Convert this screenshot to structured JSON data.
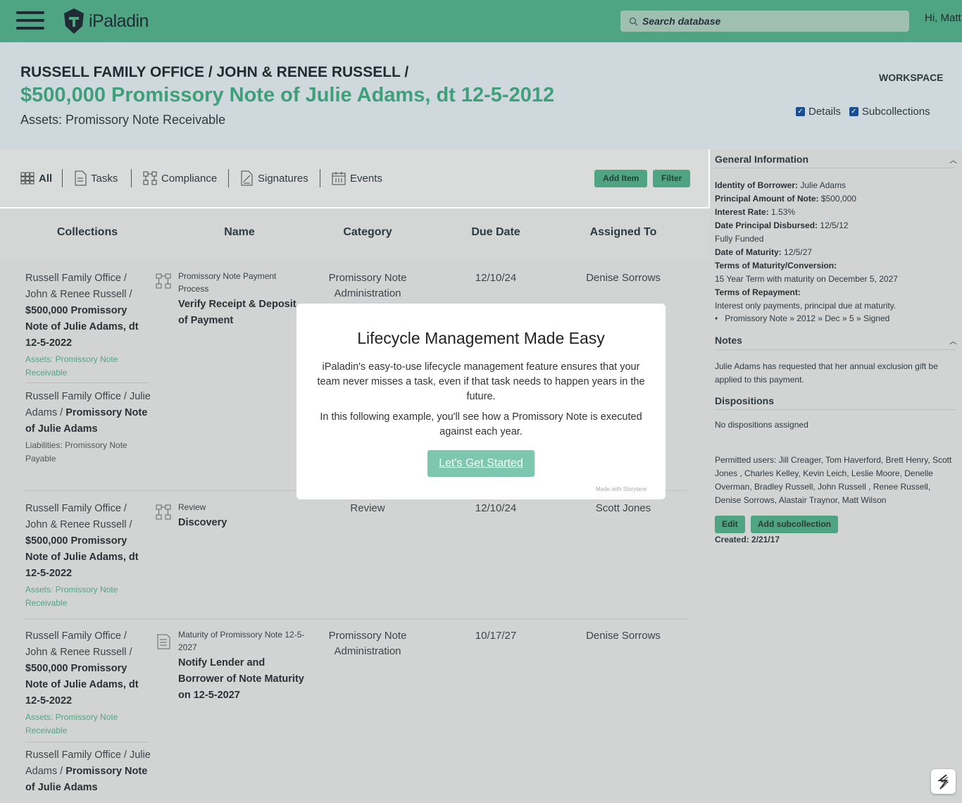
{
  "app": {
    "logo_text": "iPaladin",
    "search_placeholder": "Search database",
    "greeting": "Hi, Matt"
  },
  "header": {
    "breadcrumb": "RUSSELL FAMILY OFFICE / JOHN & RENEE RUSSELL /",
    "title": "$500,000 Promissory Note of Julie Adams, dt 12-5-2012",
    "subtitle": "Assets: Promissory Note Receivable",
    "workspace_label": "WORKSPACE",
    "details_label": "Details",
    "subcollections_label": "Subcollections"
  },
  "tabs": {
    "all": "All",
    "tasks": "Tasks",
    "compliance": "Compliance",
    "signatures": "Signatures",
    "events": "Events",
    "add_item": "Add Item",
    "filter": "Filter"
  },
  "table": {
    "headers": {
      "collections": "Collections",
      "name": "Name",
      "category": "Category",
      "due_date": "Due Date",
      "assigned_to": "Assigned To"
    },
    "rows": [
      {
        "coll_a_plain": "Russell Family Office / John & Renee Russell /",
        "coll_a_bold": "$500,000 Promissory Note of Julie Adams, dt 12-5-2022",
        "coll_a_tag": "Assets: Promissory Note Receivable",
        "coll_b_plain": "Russell Family Office / Julie Adams /",
        "coll_b_bold": "Promissory Note of Julie Adams",
        "coll_b_tag": "Liabilities: Promissory Note Payable",
        "process": "Promissory Note Payment Process",
        "title": "Verify Receipt & Deposit of Payment",
        "category": "Promissory Note Administration",
        "due": "12/10/24",
        "assigned": "Denise Sorrows"
      },
      {
        "coll_a_plain": "Russell Family Office / John & Renee Russell /",
        "coll_a_bold": "$500,000 Promissory Note of Julie Adams, dt 12-5-2022",
        "coll_a_tag": "Assets: Promissory Note Receivable",
        "process": "Review",
        "title": "Discovery",
        "category": "Review",
        "due": "12/10/24",
        "assigned": "Scott Jones"
      },
      {
        "coll_a_plain": "Russell Family Office / John & Renee Russell /",
        "coll_a_bold": "$500,000 Promissory Note of Julie Adams, dt 12-5-2022",
        "coll_a_tag": "Assets: Promissory Note Receivable",
        "coll_b_plain": "Russell Family Office / Julie Adams /",
        "coll_b_bold": "Promissory Note of Julie Adams",
        "process": "Maturity of Promissory Note 12-5-2027",
        "title": "Notify Lender and Borrower of Note Maturity on 12-5-2027",
        "category": "Promissory Note Administration",
        "due": "10/17/27",
        "assigned": "Denise Sorrows"
      }
    ]
  },
  "panel": {
    "general_title": "General Information",
    "borrower_label": "Identity of Borrower:",
    "borrower_value": "Julie Adams",
    "principal_label": "Principal Amount of Note:",
    "principal_value": "$500,000",
    "rate_label": "Interest Rate:",
    "rate_value": "1.53%",
    "disbursed_label": "Date Principal Disbursed:",
    "disbursed_value": "12/5/12",
    "funded": "Fully Funded",
    "maturity_label": "Date of Maturity:",
    "maturity_value": "12/5/27",
    "terms_maturity_label": "Terms of Maturity/Conversion:",
    "terms_maturity_value": "15 Year Term with maturity on December 5, 2027",
    "terms_repayment_label": "Terms of Repayment:",
    "terms_repayment_value": "Interest only payments, principal due at maturity.",
    "path": "Promissory Note » 2012 » Dec » 5 » Signed",
    "notes_title": "Notes",
    "notes_text": "Julie Adams has requested that her annual exclusion gift be applied to this payment.",
    "dispositions_title": "Dispositions",
    "dispositions_text": "No dispositions assigned",
    "permitted": "Permitted users: Jill Creager, Tom Haverford, Brett Henry, Scott Jones , Charles Kelley, Kevin Leich, Leslie Moore, Denelle Overman, Bradley Russell, John Russell , Renee Russell, Denise Sorrows, Alastair Traynor, Matt Wilson",
    "edit": "Edit",
    "add_sub": "Add subcollection",
    "created": "Created: 2/21/17"
  },
  "modal": {
    "title": "Lifecycle Management Made Easy",
    "p1": "iPaladin's easy-to-use lifecycle management feature ensures that your team never misses a task, even if that task needs to happen years in the future.",
    "p2": "In this following example, you'll see how a Promissory Note is executed against each year.",
    "button": "Let's Get Started",
    "made_with": "Made with Storylane"
  },
  "colors": {
    "brand_green": "#4fa583",
    "title_green": "#3f9f7a",
    "overlay_gray": "#d2d4d4"
  }
}
